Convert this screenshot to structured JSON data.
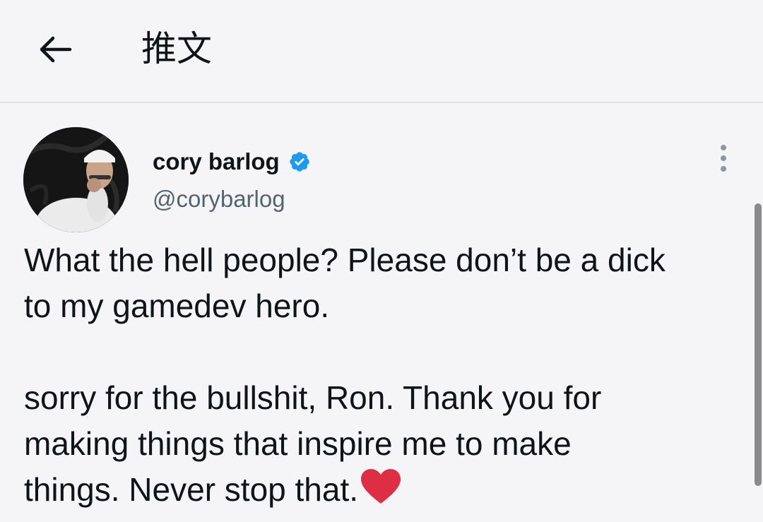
{
  "header": {
    "back_icon": "arrow-left-icon",
    "title": "推文"
  },
  "author": {
    "display_name": "cory barlog",
    "verified_icon": "verified-badge-icon",
    "verified_color": "#1d9bf0",
    "handle": "@corybarlog",
    "more_icon": "more-vertical-icon"
  },
  "tweet": {
    "paragraph_1_line_1": "What the hell people? Please don’t be a dick",
    "paragraph_1_line_2": "to my gamedev hero.",
    "paragraph_2_line_1": "sorry for the bullshit, Ron. Thank you for",
    "paragraph_2_line_2": "making things that inspire me to make",
    "paragraph_2_line_3": "things. Never stop that.",
    "emoji_icon": "red-heart-icon",
    "emoji_color": "#dd2e44"
  },
  "theme": {
    "background": "#f5f5f7",
    "text": "#0f1419",
    "secondary_text": "#536471"
  }
}
